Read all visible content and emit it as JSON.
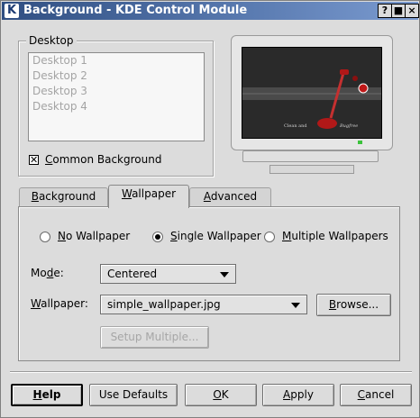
{
  "window": {
    "title": "Background - KDE Control Module",
    "app_icon": "K",
    "controls": [
      {
        "name": "help",
        "glyph": "?"
      },
      {
        "name": "maximize",
        "glyph": "■"
      },
      {
        "name": "close",
        "glyph": "×"
      }
    ]
  },
  "desktop_group": {
    "title": "Desktop",
    "items": [
      "Desktop 1",
      "Desktop 2",
      "Desktop 3",
      "Desktop 4"
    ],
    "common_background": {
      "label_u": "C",
      "label_rest": "ommon Background",
      "checked": true
    }
  },
  "preview": {
    "caption": "Clean and",
    "brand": "Bugfree"
  },
  "tabs": [
    {
      "u": "B",
      "rest": "ackground",
      "active": false
    },
    {
      "u": "W",
      "rest": "allpaper",
      "active": true
    },
    {
      "u": "A",
      "rest": "dvanced",
      "active": false
    }
  ],
  "wallpaper_options": [
    {
      "u": "N",
      "rest": "o Wallpaper",
      "selected": false
    },
    {
      "u": "S",
      "rest": "ingle Wallpaper",
      "selected": true
    },
    {
      "u": "M",
      "rest": "ultiple Wallpapers",
      "selected": false
    }
  ],
  "mode": {
    "label_pre": "Mo",
    "label_u": "d",
    "label_post": "e:",
    "value": "Centered"
  },
  "wallpaper": {
    "label_u": "W",
    "label_rest": "allpaper:",
    "value": "simple_wallpaper.jpg"
  },
  "browse": {
    "u": "B",
    "rest": "rowse..."
  },
  "setup_multiple": {
    "label": "Setup Multiple..."
  },
  "footer": {
    "help": {
      "u": "H",
      "rest": "elp"
    },
    "use_defaults": {
      "label": "Use Defaults"
    },
    "ok": {
      "u": "O",
      "rest": "K"
    },
    "apply": {
      "u": "A",
      "rest": "pply"
    },
    "cancel": {
      "u": "C",
      "rest": "ancel"
    }
  },
  "colors": {
    "title_bar": "#304f82",
    "window_bg": "#dcdcdc",
    "vacuum_red": "#b01818"
  }
}
